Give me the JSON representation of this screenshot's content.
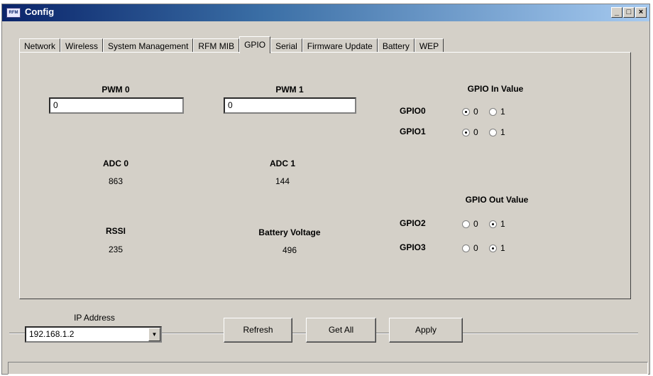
{
  "window": {
    "title": "Config"
  },
  "tabs": [
    {
      "label": "Network"
    },
    {
      "label": "Wireless"
    },
    {
      "label": "System Management"
    },
    {
      "label": "RFM MIB"
    },
    {
      "label": "GPIO"
    },
    {
      "label": "Serial"
    },
    {
      "label": "Firmware Update"
    },
    {
      "label": "Battery"
    },
    {
      "label": "WEP"
    }
  ],
  "active_tab": "GPIO",
  "pwm0": {
    "label": "PWM 0",
    "value": "0"
  },
  "pwm1": {
    "label": "PWM 1",
    "value": "0"
  },
  "adc0": {
    "label": "ADC 0",
    "value": "863"
  },
  "adc1": {
    "label": "ADC 1",
    "value": "144"
  },
  "rssi": {
    "label": "RSSI",
    "value": "235"
  },
  "battery": {
    "label": "Battery Voltage",
    "value": "496"
  },
  "gpio_in": {
    "title": "GPIO In Value",
    "rows": [
      {
        "name": "GPIO0",
        "opt0": "0",
        "opt1": "1",
        "selected": "0"
      },
      {
        "name": "GPIO1",
        "opt0": "0",
        "opt1": "1",
        "selected": "0"
      }
    ]
  },
  "gpio_out": {
    "title": "GPIO Out Value",
    "rows": [
      {
        "name": "GPIO2",
        "opt0": "0",
        "opt1": "1",
        "selected": "1"
      },
      {
        "name": "GPIO3",
        "opt0": "0",
        "opt1": "1",
        "selected": "1"
      }
    ]
  },
  "footer": {
    "ip_label": "IP Address",
    "ip_value": "192.168.1.2",
    "refresh": "Refresh",
    "get_all": "Get All",
    "apply": "Apply"
  },
  "colors": {
    "window_bg": "#d4d0c8",
    "title_start": "#0a246a",
    "title_end": "#a6caf0"
  }
}
